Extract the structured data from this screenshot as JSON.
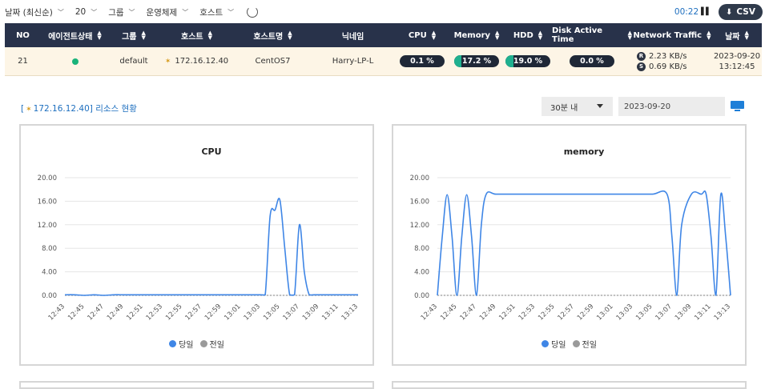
{
  "filters": [
    {
      "label": "날짜 (최신순)"
    },
    {
      "label": "20"
    },
    {
      "label": "그룹"
    },
    {
      "label": "운영체제"
    },
    {
      "label": "호스트"
    }
  ],
  "toolbar": {
    "timer": "00:22",
    "csv_label": "CSV"
  },
  "table": {
    "headers": [
      "NO",
      "에이전트상태",
      "그룹",
      "호스트",
      "호스트명",
      "닉네임",
      "CPU",
      "Memory",
      "HDD",
      "Disk Active Time",
      "Network Traffic",
      "날짜"
    ],
    "row": {
      "no": "21",
      "group": "default",
      "host": "172.16.12.40",
      "hostname": "CentOS7",
      "nickname": "Harry-LP-L",
      "cpu": "0.1 %",
      "cpu_pct": 0.1,
      "memory": "17.2 %",
      "memory_pct": 17.2,
      "hdd": "19.0 %",
      "hdd_pct": 19.0,
      "disk": "0.0 %",
      "disk_pct": 0.0,
      "net_r_label": "R",
      "net_r": "2.23 KB/s",
      "net_s_label": "S",
      "net_s": "0.69 KB/s",
      "date": "2023-09-20",
      "time": "13:12:45",
      "status_color": "#1ab37a"
    }
  },
  "resource": {
    "host": "172.16.12.40",
    "title_suffix": "리소스 현황",
    "range_select": "30분 내",
    "date_value": "2023-09-20"
  },
  "legend": {
    "today": "당일",
    "yesterday": "전일",
    "today_color": "#3f86e6",
    "yesterday_color": "#9a9a9a"
  },
  "chart_data": [
    {
      "type": "line",
      "title": "CPU",
      "ylim": [
        0,
        20
      ],
      "yticks": [
        "20.00",
        "16.00",
        "12.00",
        "8.00",
        "4.00",
        "0.00"
      ],
      "xticks": [
        "12:43",
        "12:45",
        "12:47",
        "12:49",
        "12:51",
        "12:53",
        "12:55",
        "12:57",
        "12:59",
        "13:01",
        "13:03",
        "13:05",
        "13:07",
        "13:09",
        "13:11",
        "13:13"
      ],
      "series": [
        {
          "name": "당일",
          "color": "#3f86e6",
          "x": [
            0,
            1,
            2,
            3,
            4,
            5,
            6,
            7,
            8,
            9,
            10,
            10.5,
            11,
            11.5,
            12,
            12.5,
            13,
            14,
            15,
            15.5,
            16,
            17,
            18,
            19,
            20,
            21,
            22,
            23,
            24,
            25,
            26,
            27,
            28,
            29,
            30
          ],
          "y": [
            0.1,
            0.1,
            0.0,
            0.1,
            0.0,
            0.1,
            0.1,
            0.1,
            0.1,
            0.1,
            0.1,
            0.1,
            0.1,
            0.1,
            0.1,
            0.1,
            0.1,
            0.1,
            0.1,
            0.1,
            0.1,
            0.1,
            0.1,
            0.1,
            0.1,
            0.1,
            0.1,
            0.1,
            0.1,
            0.1,
            0.1,
            0.1,
            0.1,
            0.1,
            0.1
          ]
        },
        {
          "name": "전일",
          "color": "#9a9a9a",
          "x": [
            0,
            30
          ],
          "y": [
            0,
            0
          ]
        }
      ],
      "peaks": [
        {
          "x": [
            20,
            20.5,
            21,
            21.5,
            22,
            22.5,
            23,
            23.5,
            24,
            24.5,
            25,
            25.5,
            26,
            26.5,
            27,
            30
          ],
          "y": [
            0.1,
            0.1,
            13.5,
            14.5,
            16.2,
            8.0,
            0.1,
            0.1,
            12.0,
            4.0,
            0.1,
            0.1,
            0.1,
            0.1,
            0.1,
            0.1
          ]
        }
      ]
    },
    {
      "type": "line",
      "title": "memory",
      "ylim": [
        0,
        20
      ],
      "yticks": [
        "20.00",
        "16.00",
        "12.00",
        "8.00",
        "4.00",
        "0.00"
      ],
      "xticks": [
        "12:43",
        "12:45",
        "12:47",
        "12:49",
        "12:51",
        "12:53",
        "12:55",
        "12:57",
        "12:59",
        "13:01",
        "13:03",
        "13:05",
        "13:07",
        "13:09",
        "13:11",
        "13:13"
      ],
      "series": [
        {
          "name": "당일",
          "color": "#3f86e6",
          "x": [
            0,
            0.5,
            1,
            1.5,
            2,
            2.5,
            3,
            3.5,
            4,
            4.5,
            5,
            6,
            8,
            10,
            12,
            14,
            16,
            18,
            20,
            22,
            23.5,
            24,
            24.5,
            25,
            26,
            27,
            27.5,
            28,
            28.5,
            29,
            29.5,
            30
          ],
          "y": [
            0,
            10,
            17.1,
            10,
            0,
            10,
            17.1,
            10,
            0,
            12,
            17.2,
            17.2,
            17.2,
            17.2,
            17.2,
            17.2,
            17.2,
            17.2,
            17.2,
            17.2,
            17.2,
            10,
            0,
            12,
            17.2,
            17.2,
            17.2,
            10,
            0,
            17.1,
            10,
            0
          ]
        },
        {
          "name": "전일",
          "color": "#9a9a9a",
          "x": [
            0,
            30
          ],
          "y": [
            0,
            0
          ]
        }
      ]
    }
  ]
}
